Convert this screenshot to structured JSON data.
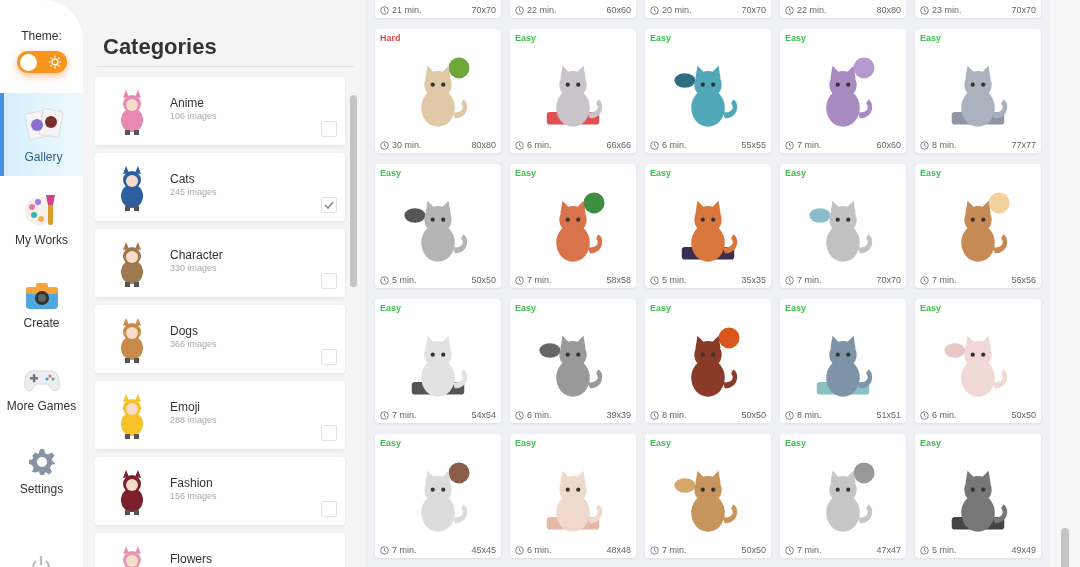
{
  "sidebar": {
    "theme_label": "Theme:",
    "dark_mode": false,
    "items": [
      {
        "label": "Gallery",
        "kind": "gallery",
        "selected": true
      },
      {
        "label": "My Works",
        "kind": "palette",
        "selected": false
      },
      {
        "label": "Create",
        "kind": "camera",
        "selected": false
      },
      {
        "label": "More Games",
        "kind": "gamepad",
        "selected": false
      },
      {
        "label": "Settings",
        "kind": "gear",
        "selected": false
      }
    ]
  },
  "categories": {
    "title": "Categories",
    "items": [
      {
        "name": "Anime",
        "count": "106 images",
        "checked": false
      },
      {
        "name": "Cats",
        "count": "245 images",
        "checked": true
      },
      {
        "name": "Character",
        "count": "330 images",
        "checked": false
      },
      {
        "name": "Dogs",
        "count": "366 images",
        "checked": false
      },
      {
        "name": "Emoji",
        "count": "288 images",
        "checked": false
      },
      {
        "name": "Fashion",
        "count": "156 images",
        "checked": false
      },
      {
        "name": "Flowers"
      }
    ]
  },
  "gallery": {
    "partial_row": [
      {
        "time": "21 min.",
        "size": "70x70"
      },
      {
        "time": "22 min.",
        "size": "60x60"
      },
      {
        "time": "20 min.",
        "size": "70x70"
      },
      {
        "time": "22 min.",
        "size": "80x80"
      },
      {
        "time": "23 min.",
        "size": "70x70"
      }
    ],
    "cards": [
      {
        "difficulty": "Hard",
        "kind": "hard",
        "time": "30 min.",
        "size": "80x80"
      },
      {
        "difficulty": "Easy",
        "kind": "easy",
        "time": "6 min.",
        "size": "66x66"
      },
      {
        "difficulty": "Easy",
        "kind": "easy",
        "time": "6 min.",
        "size": "55x55"
      },
      {
        "difficulty": "Easy",
        "kind": "easy",
        "time": "7 min.",
        "size": "60x60"
      },
      {
        "difficulty": "Easy",
        "kind": "easy",
        "time": "8 min.",
        "size": "77x77"
      },
      {
        "difficulty": "Easy",
        "kind": "easy",
        "time": "5 min.",
        "size": "50x50"
      },
      {
        "difficulty": "Easy",
        "kind": "easy",
        "time": "7 min.",
        "size": "58x58"
      },
      {
        "difficulty": "Easy",
        "kind": "easy",
        "time": "5 min.",
        "size": "35x35"
      },
      {
        "difficulty": "Easy",
        "kind": "easy",
        "time": "7 min.",
        "size": "70x70"
      },
      {
        "difficulty": "Easy",
        "kind": "easy",
        "time": "7 min.",
        "size": "56x56"
      },
      {
        "difficulty": "Easy",
        "kind": "easy",
        "time": "7 min.",
        "size": "54x54"
      },
      {
        "difficulty": "Easy",
        "kind": "easy",
        "time": "6 min.",
        "size": "39x39"
      },
      {
        "difficulty": "Easy",
        "kind": "easy",
        "time": "8 min.",
        "size": "50x50"
      },
      {
        "difficulty": "Easy",
        "kind": "easy",
        "time": "8 min.",
        "size": "51x51"
      },
      {
        "difficulty": "Easy",
        "kind": "easy",
        "time": "6 min.",
        "size": "50x50"
      },
      {
        "difficulty": "Easy",
        "kind": "easy",
        "time": "7 min.",
        "size": "45x45"
      },
      {
        "difficulty": "Easy",
        "kind": "easy",
        "time": "6 min.",
        "size": "48x48"
      },
      {
        "difficulty": "Easy",
        "kind": "easy",
        "time": "7 min.",
        "size": "50x50"
      },
      {
        "difficulty": "Easy",
        "kind": "easy",
        "time": "7 min.",
        "size": "47x47"
      },
      {
        "difficulty": "Easy",
        "kind": "easy",
        "time": "5 min.",
        "size": "49x49"
      }
    ]
  }
}
